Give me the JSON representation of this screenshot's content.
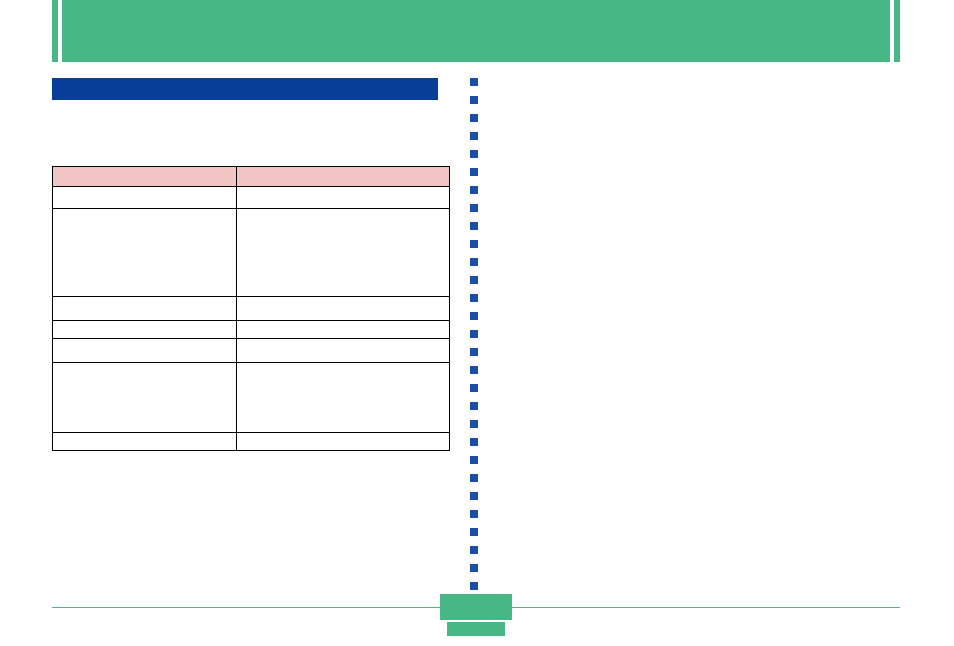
{
  "header": {
    "title": ""
  },
  "section": {
    "heading": ""
  },
  "table": {
    "headers": [
      "",
      ""
    ],
    "rows": [
      {
        "h": "short",
        "cells": [
          "",
          ""
        ]
      },
      {
        "h": "tall",
        "cells": [
          "",
          ""
        ]
      },
      {
        "h": "med",
        "cells": [
          "",
          ""
        ]
      },
      {
        "h": "xs",
        "cells": [
          "",
          ""
        ]
      },
      {
        "h": "med",
        "cells": [
          "",
          ""
        ]
      },
      {
        "h": "big",
        "cells": [
          "",
          ""
        ]
      },
      {
        "h": "xs",
        "cells": [
          "",
          ""
        ]
      }
    ]
  },
  "footer": {
    "page_label": "",
    "page_number": ""
  },
  "colors": {
    "accent_green": "#47b785",
    "accent_blue": "#1a4fa3",
    "section_blue": "#0a3f99",
    "header_pink": "#f2c5c5"
  }
}
